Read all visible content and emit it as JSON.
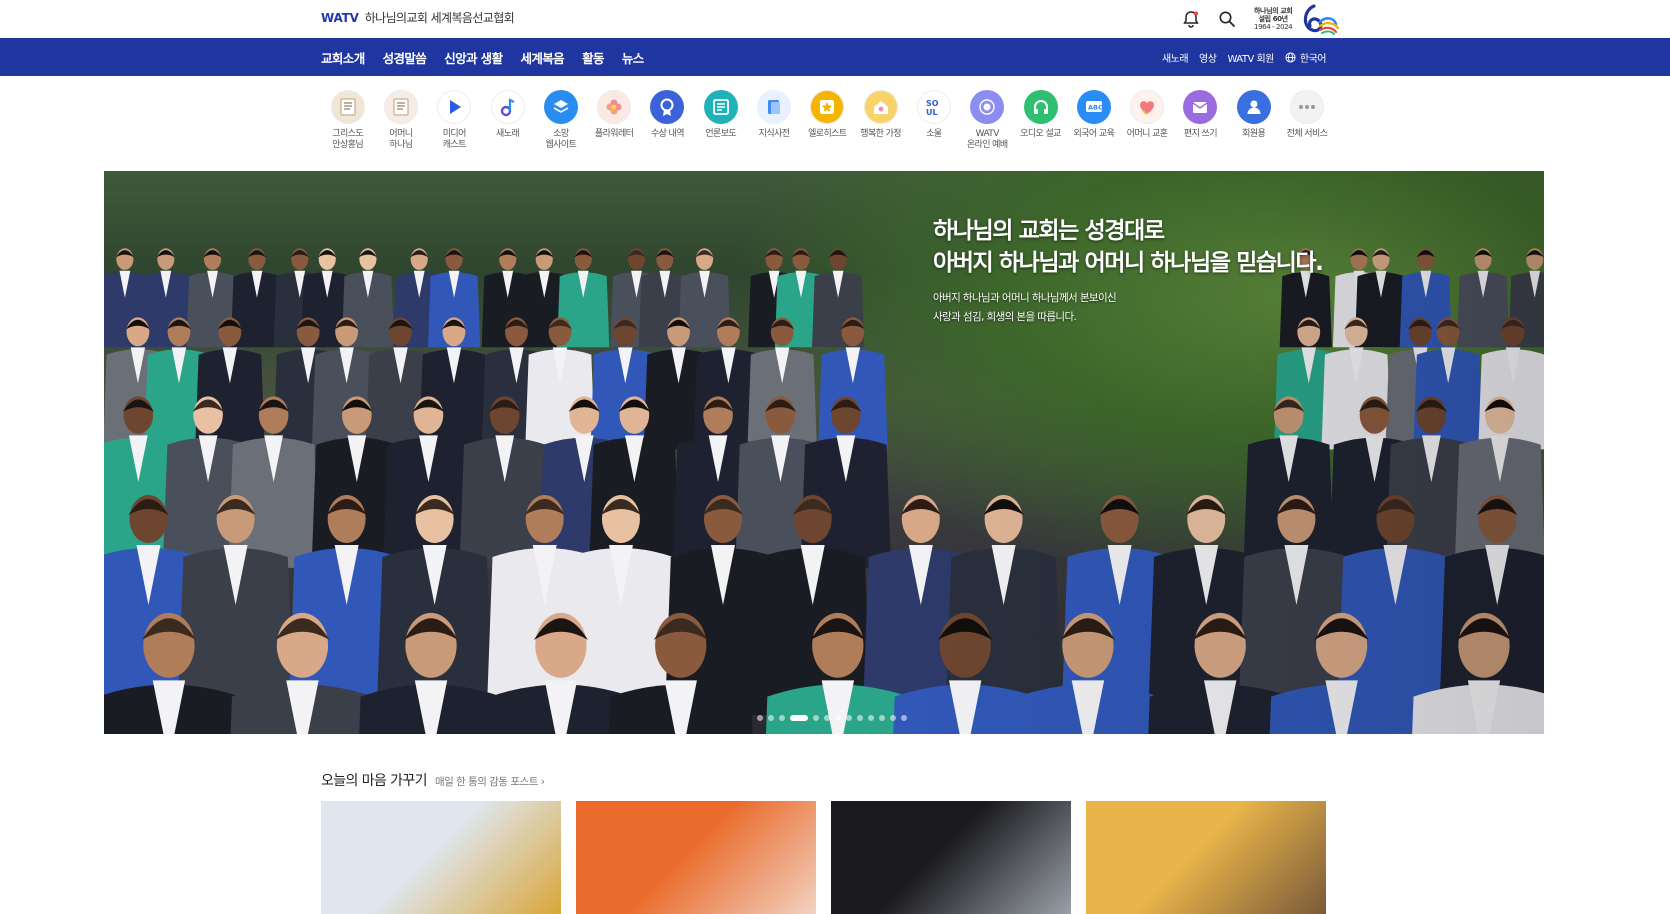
{
  "topbar": {
    "brand": "WATV",
    "church_name": "하나님의교회 세계복음선교협회",
    "icons": [
      "bell-icon",
      "search-icon"
    ],
    "anniversary": {
      "line1": "하나님의 교회",
      "line2": "설립 60년",
      "years": "1964 - 2024"
    }
  },
  "nav": {
    "menu": [
      "교회소개",
      "성경말씀",
      "신앙과 생활",
      "세계복음",
      "활동",
      "뉴스"
    ],
    "util": [
      "새노래",
      "영상",
      "WATV 회원"
    ],
    "language": "한국어"
  },
  "services": [
    {
      "label": "그리스도\n안상홍님",
      "icon": "book-icon",
      "color": "#f1e6d6"
    },
    {
      "label": "어머니\n하나님",
      "icon": "book-icon",
      "color": "#f6ece4"
    },
    {
      "label": "미디어\n캐스트",
      "icon": "play-icon",
      "color": "#ffffff"
    },
    {
      "label": "새노래",
      "icon": "music-note-icon",
      "color": "#ffffff"
    },
    {
      "label": "소망\n웹사이트",
      "icon": "stack-icon",
      "color": "#2b8cf0"
    },
    {
      "label": "플라워레터",
      "icon": "flower-icon",
      "color": "#fbe9e4"
    },
    {
      "label": "수상 내역",
      "icon": "award-icon",
      "color": "#3a63d8"
    },
    {
      "label": "언론보도",
      "icon": "newspaper-icon",
      "color": "#1fb3b9"
    },
    {
      "label": "지식사전",
      "icon": "dictionary-icon",
      "color": "#e9f1ff"
    },
    {
      "label": "엘로히스트",
      "icon": "star-icon",
      "color": "#f5b400"
    },
    {
      "label": "행복한 가정",
      "icon": "house-icon",
      "color": "#f8d36a"
    },
    {
      "label": "소울",
      "icon": "soul-icon",
      "color": "#ffffff"
    },
    {
      "label": "WATV\n온라인 예배",
      "icon": "online-worship-icon",
      "color": "#8b8ef0"
    },
    {
      "label": "오디오 설교",
      "icon": "headphones-icon",
      "color": "#2fbf71"
    },
    {
      "label": "외국어 교육",
      "icon": "abc-icon",
      "color": "#2a8cf5"
    },
    {
      "label": "어머니 교훈",
      "icon": "heart-icon",
      "color": "#fff1ee"
    },
    {
      "label": "편지 쓰기",
      "icon": "mail-icon",
      "color": "#9b6be0"
    },
    {
      "label": "회원용",
      "icon": "user-icon",
      "color": "#3a6fe0"
    },
    {
      "label": "전체 서비스",
      "icon": "more-icon",
      "color": "#f2f2f2"
    }
  ],
  "hero": {
    "title_line1": "하나님의 교회는 성경대로",
    "title_line2": "아버지 하나님과 어머니 하나님을 믿습니다.",
    "sub_line1": "아버지 하나님과 어머니 하나님께서 본보이신",
    "sub_line2": "사랑과 섬김, 희생의 본을 따릅니다.",
    "slide_count": 13,
    "active_slide": 4
  },
  "section": {
    "title": "오늘의 마음 가꾸기",
    "more": "매일 한 통의 감동 포스트"
  },
  "cards": [
    {
      "name": "woman-phone-card",
      "colors": [
        "#dfe6ee",
        "#d9a63a"
      ]
    },
    {
      "name": "sparrow-hands-card",
      "colors": [
        "#e96a2a",
        "#f2d2c2"
      ]
    },
    {
      "name": "sword-card",
      "colors": [
        "#1b1b1f",
        "#9aa0a8"
      ]
    },
    {
      "name": "desert-figure-card",
      "colors": [
        "#e9b44a",
        "#7a5a3a"
      ]
    }
  ]
}
